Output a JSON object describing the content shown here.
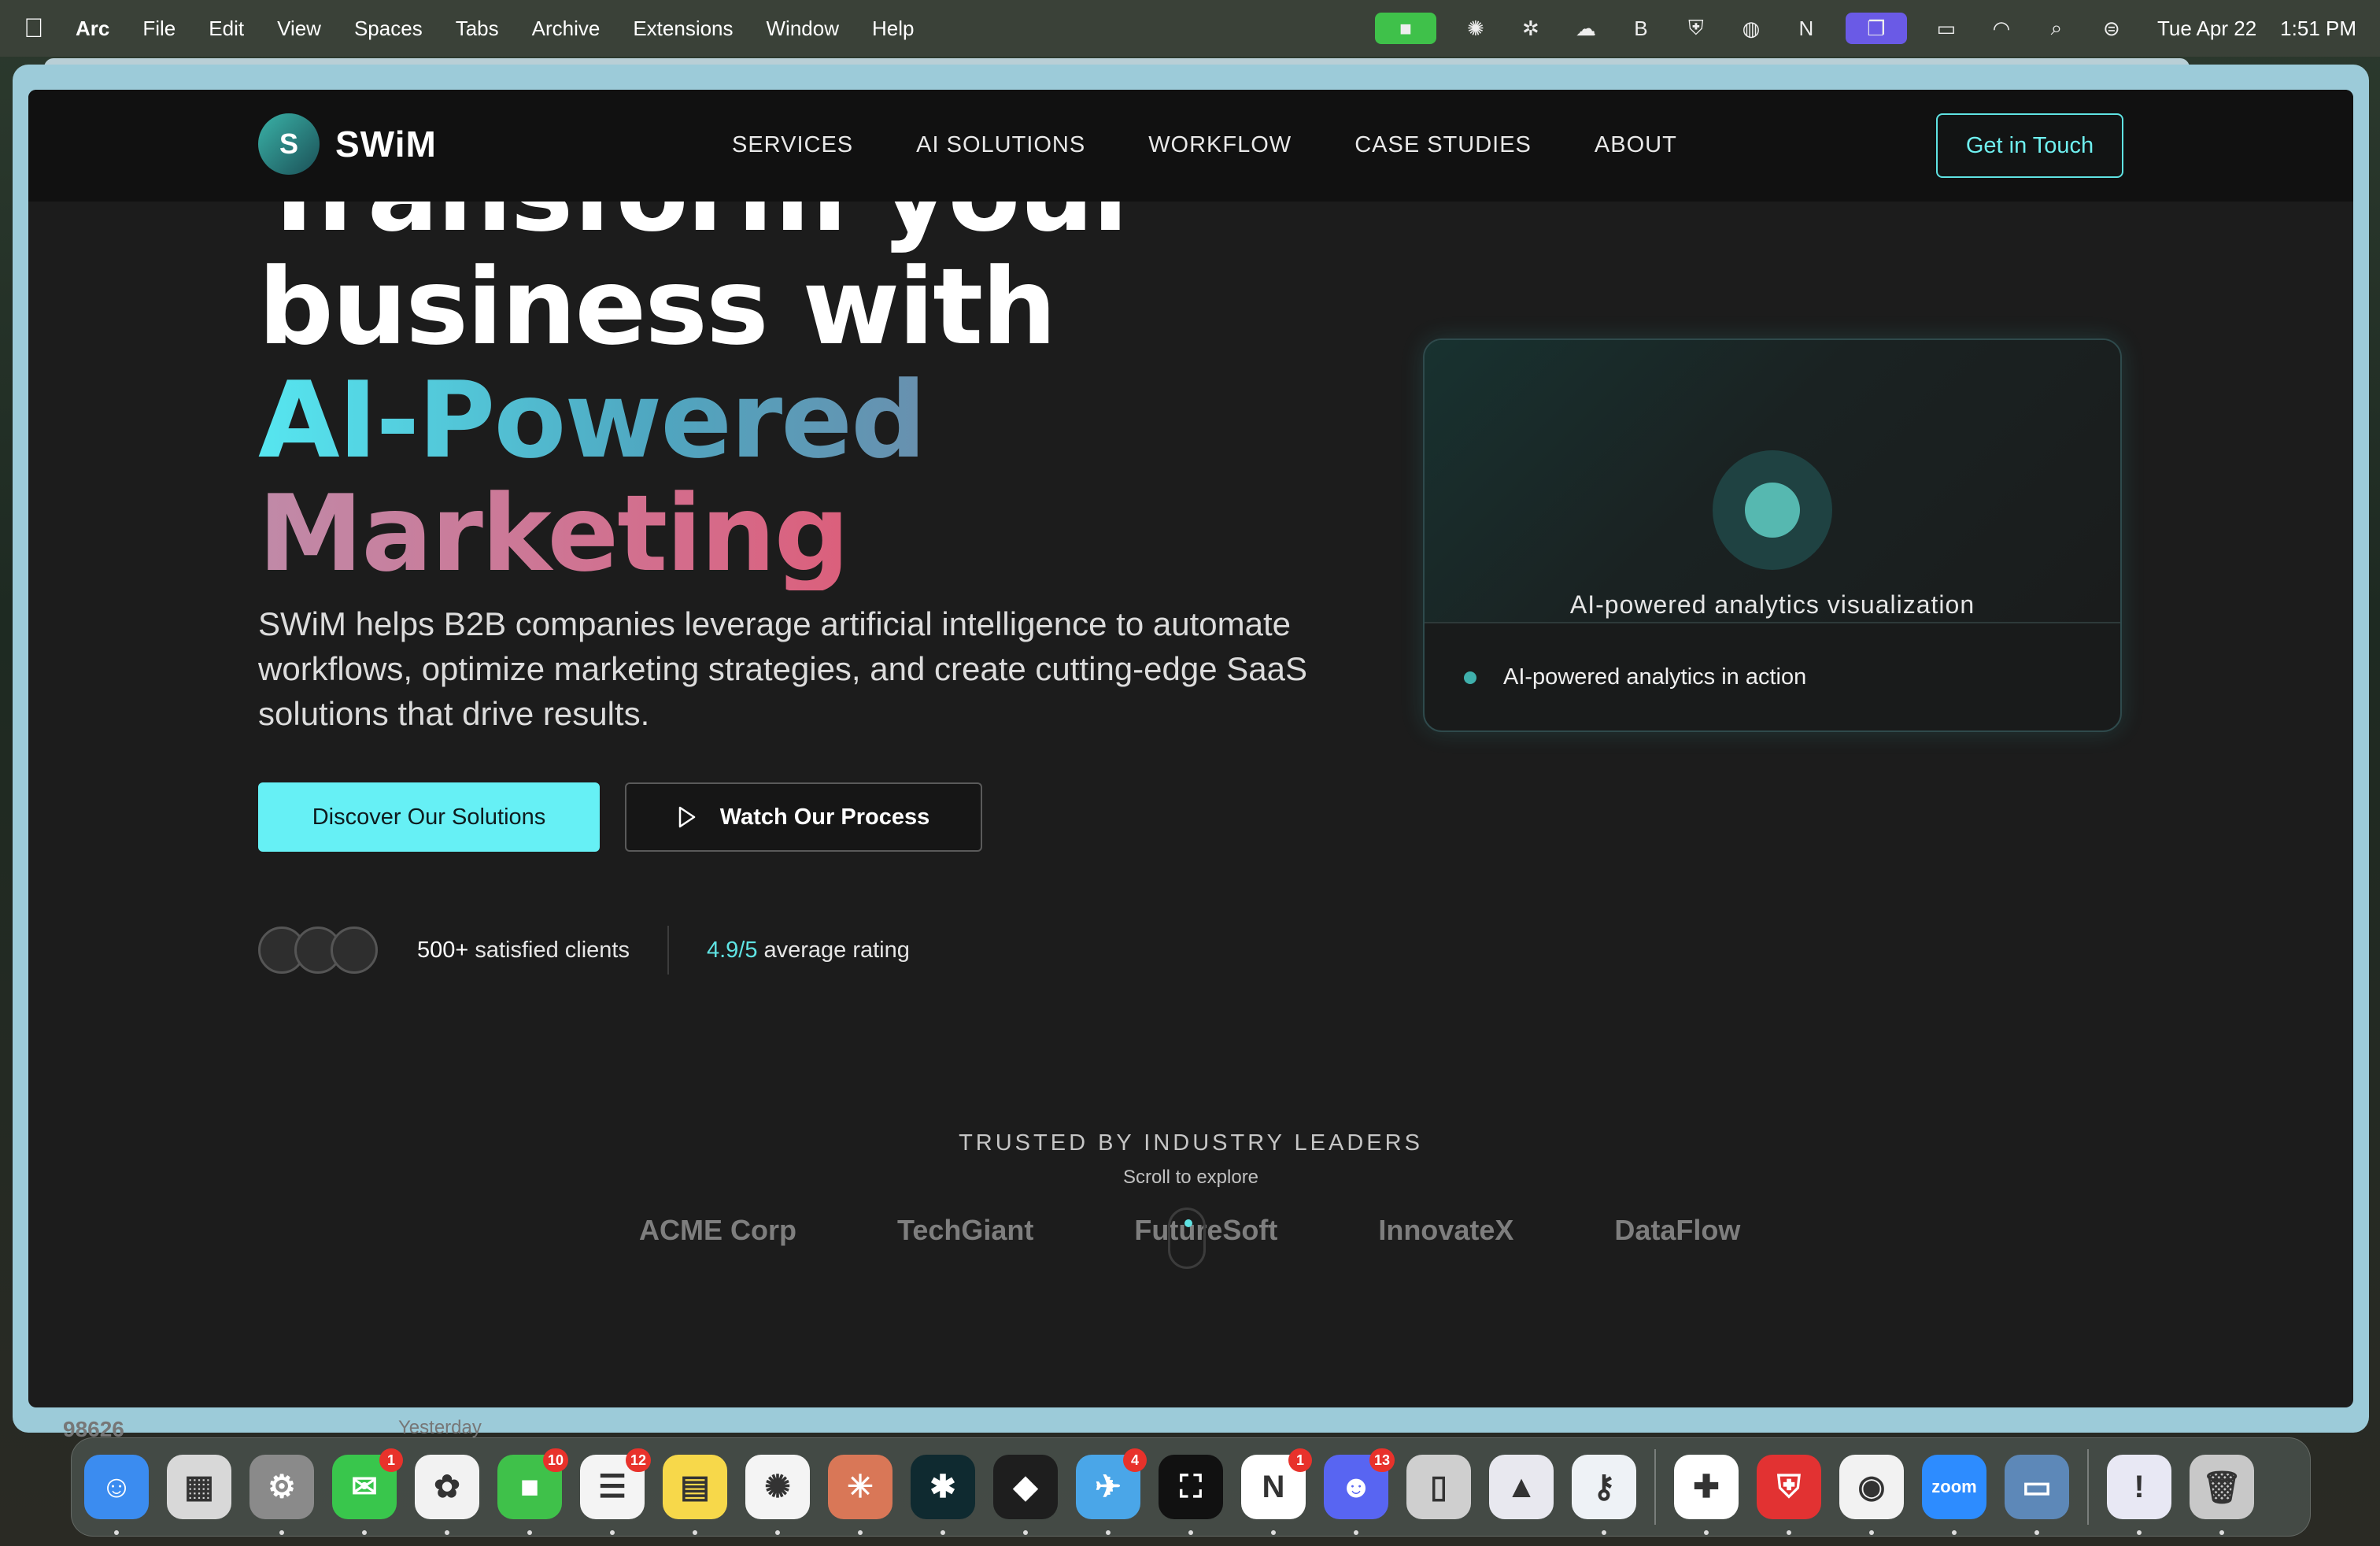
{
  "menubar": {
    "app_name": "Arc",
    "menus": [
      "File",
      "Edit",
      "View",
      "Spaces",
      "Tabs",
      "Archive",
      "Extensions",
      "Window",
      "Help"
    ],
    "clock_date": "Tue Apr 22",
    "clock_time": "1:51 PM"
  },
  "site": {
    "logo_letter": "S",
    "logo_text": "SWiM",
    "nav": [
      "SERVICES",
      "AI SOLUTIONS",
      "WORKFLOW",
      "CASE STUDIES",
      "ABOUT"
    ],
    "cta": "Get in Touch"
  },
  "hero": {
    "line1": "Transform your",
    "line2": "business with",
    "line3": "AI-Powered",
    "line4": "Marketing",
    "description": "SWiM helps B2B companies leverage artificial intelligence to automate workflows, optimize marketing strategies, and create cutting-edge SaaS solutions that drive results.",
    "primary_button": "Discover Our Solutions",
    "secondary_button": "Watch Our Process",
    "clients_count": "500+",
    "clients_label": "satisfied clients",
    "rating_value": "4.9/5",
    "rating_label": "average rating"
  },
  "card": {
    "caption": "AI-powered analytics visualization",
    "status": "AI-powered analytics in action"
  },
  "trusted": {
    "heading": "TRUSTED BY INDUSTRY LEADERS",
    "scroll_hint": "Scroll to explore",
    "logos": [
      "ACME Corp",
      "TechGiant",
      "FutureSoft",
      "InnovateX",
      "DataFlow"
    ]
  },
  "background_window": {
    "partial_text": "98626",
    "partial_date": "Yesterday"
  },
  "dock": {
    "apps": [
      {
        "name": "Finder",
        "color": "#3b8cf0",
        "glyph": "☺",
        "badge": ""
      },
      {
        "name": "Launchpad",
        "color": "#d8d8d8",
        "glyph": "▦",
        "badge": ""
      },
      {
        "name": "System Settings",
        "color": "#8a8a8a",
        "glyph": "⚙",
        "badge": ""
      },
      {
        "name": "Messages",
        "color": "#39c64c",
        "glyph": "✉",
        "badge": "1"
      },
      {
        "name": "Photos",
        "color": "#f2f2f2",
        "glyph": "✿",
        "badge": ""
      },
      {
        "name": "FaceTime",
        "color": "#3fc14a",
        "glyph": "■",
        "badge": "10"
      },
      {
        "name": "Reminders",
        "color": "#f4f4f4",
        "glyph": "☰",
        "badge": "12"
      },
      {
        "name": "Notes",
        "color": "#f7d84a",
        "glyph": "▤",
        "badge": ""
      },
      {
        "name": "ChatGPT",
        "color": "#f4f4f4",
        "glyph": "✺",
        "badge": ""
      },
      {
        "name": "Claude",
        "color": "#d97757",
        "glyph": "✳",
        "badge": ""
      },
      {
        "name": "Perplexity",
        "color": "#0f2a30",
        "glyph": "✱",
        "badge": ""
      },
      {
        "name": "Figma",
        "color": "#1e1e1e",
        "glyph": "◆",
        "badge": ""
      },
      {
        "name": "Airmail",
        "color": "#4aa6e8",
        "glyph": "✈",
        "badge": "4"
      },
      {
        "name": "Screen Studio",
        "color": "#111111",
        "glyph": "⛶",
        "badge": ""
      },
      {
        "name": "Notion",
        "color": "#ffffff",
        "glyph": "N",
        "badge": "1"
      },
      {
        "name": "Discord",
        "color": "#5865f2",
        "glyph": "☻",
        "badge": "13"
      },
      {
        "name": "iPhone Mirroring",
        "color": "#cfcfcf",
        "glyph": "▯",
        "badge": ""
      },
      {
        "name": "Affinity",
        "color": "#e8e8ef",
        "glyph": "▲",
        "badge": ""
      },
      {
        "name": "Keychain",
        "color": "#eef2f6",
        "glyph": "⚷",
        "badge": ""
      },
      {
        "name": "Slack",
        "color": "#ffffff",
        "glyph": "✚",
        "badge": ""
      },
      {
        "name": "Bitdefender",
        "color": "#e23232",
        "glyph": "⛨",
        "badge": ""
      },
      {
        "name": "Chrome",
        "color": "#f2f2f2",
        "glyph": "◉",
        "badge": ""
      },
      {
        "name": "Zoom",
        "color": "#2d8cff",
        "glyph": "zoom",
        "badge": ""
      },
      {
        "name": "Screen Sharing",
        "color": "#5d88b8",
        "glyph": "▭",
        "badge": ""
      },
      {
        "name": "Preview Document",
        "color": "#e8e8f4",
        "glyph": "!",
        "badge": ""
      },
      {
        "name": "Trash",
        "color": "#c8c8c8",
        "glyph": "🗑",
        "badge": ""
      }
    ]
  }
}
